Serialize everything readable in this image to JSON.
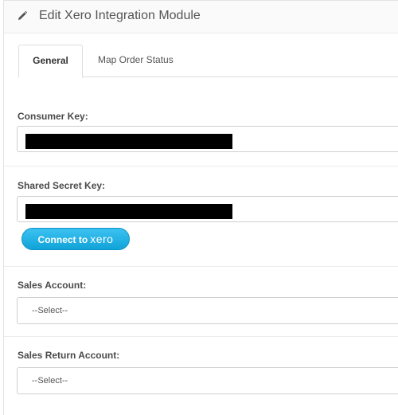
{
  "panel": {
    "title": "Edit Xero Integration Module",
    "title_icon": "pencil-icon"
  },
  "tabs": [
    {
      "label": "General",
      "active": true
    },
    {
      "label": "Map Order Status",
      "active": false
    }
  ],
  "form": {
    "consumer_key": {
      "label": "Consumer Key:",
      "value_state": "redacted"
    },
    "shared_secret_key": {
      "label": "Shared Secret Key:",
      "value_state": "redacted"
    },
    "connect_button": {
      "prefix": "Connect to",
      "brand": "xero"
    },
    "sales_account": {
      "label": "Sales Account:",
      "selected": "--Select--"
    },
    "sales_return_account": {
      "label": "Sales Return Account:",
      "selected": "--Select--"
    }
  },
  "colors": {
    "accent": "#13a5da",
    "text": "#555555",
    "border": "#cfcfcf"
  }
}
